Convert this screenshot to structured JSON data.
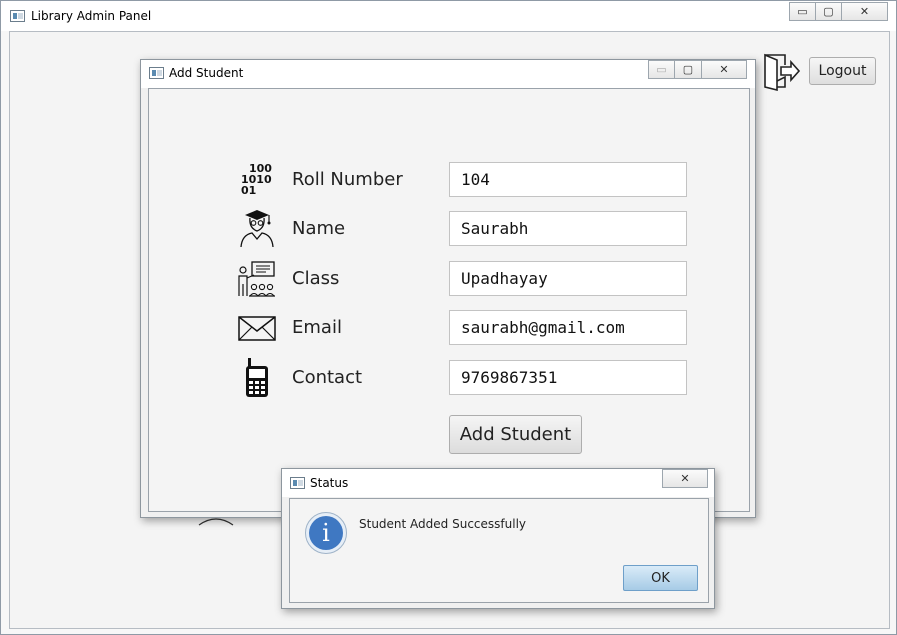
{
  "main_window": {
    "title": "Library Admin Panel",
    "controls": {
      "minimize": "▭",
      "maximize": "▢",
      "close": "✕"
    }
  },
  "header": {
    "logout_label": "Logout"
  },
  "add_student_dialog": {
    "title": "Add Student",
    "controls": {
      "minimize": "▭",
      "maximize": "▢",
      "close": "✕"
    },
    "fields": [
      {
        "label": "Roll Number",
        "value": "104",
        "icon": "binary-icon"
      },
      {
        "label": "Name",
        "value": "Saurabh",
        "icon": "graduate-icon"
      },
      {
        "label": "Class",
        "value": "Upadhayay",
        "icon": "classroom-icon"
      },
      {
        "label": "Email",
        "value": "saurabh@gmail.com",
        "icon": "envelope-icon"
      },
      {
        "label": "Contact",
        "value": "9769867351",
        "icon": "mobile-phone-icon"
      }
    ],
    "binary_icon_text": [
      "100",
      "1010",
      "01"
    ],
    "submit_label": "Add Student"
  },
  "status_dialog": {
    "title": "Status",
    "close": "✕",
    "message": "Student Added Successfully",
    "info_glyph": "i",
    "ok_label": "OK"
  },
  "colors": {
    "info_blue": "#3f78c2",
    "ok_button": "#b9d7ef"
  }
}
